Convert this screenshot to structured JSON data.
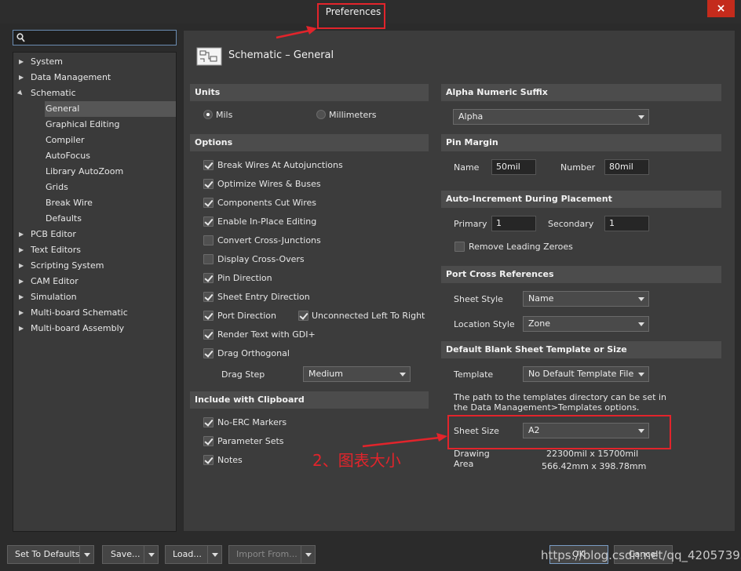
{
  "window": {
    "title": "Preferences",
    "close_label": "×"
  },
  "search": {
    "placeholder": ""
  },
  "tree": {
    "items": [
      {
        "label": "System",
        "expanded": false
      },
      {
        "label": "Data Management",
        "expanded": false
      },
      {
        "label": "Schematic",
        "expanded": true
      },
      {
        "label": "General",
        "selected": true
      },
      {
        "label": "Graphical Editing"
      },
      {
        "label": "Compiler"
      },
      {
        "label": "AutoFocus"
      },
      {
        "label": "Library AutoZoom"
      },
      {
        "label": "Grids"
      },
      {
        "label": "Break Wire"
      },
      {
        "label": "Defaults"
      },
      {
        "label": "PCB Editor",
        "expanded": false
      },
      {
        "label": "Text Editors",
        "expanded": false
      },
      {
        "label": "Scripting System",
        "expanded": false
      },
      {
        "label": "CAM Editor",
        "expanded": false
      },
      {
        "label": "Simulation",
        "expanded": false
      },
      {
        "label": "Multi-board Schematic",
        "expanded": false
      },
      {
        "label": "Multi-board Assembly",
        "expanded": false
      }
    ]
  },
  "page": {
    "title": "Schematic – General"
  },
  "units": {
    "header": "Units",
    "mils": "Mils",
    "millimeters": "Millimeters",
    "selected": "Mils"
  },
  "options": {
    "header": "Options",
    "items": [
      {
        "label": "Break Wires At Autojunctions",
        "checked": true
      },
      {
        "label": "Optimize Wires & Buses",
        "checked": true
      },
      {
        "label": "Components Cut Wires",
        "checked": true
      },
      {
        "label": "Enable In-Place Editing",
        "checked": true
      },
      {
        "label": "Convert Cross-Junctions",
        "checked": false
      },
      {
        "label": "Display Cross-Overs",
        "checked": false
      },
      {
        "label": "Pin Direction",
        "checked": true
      },
      {
        "label": "Sheet Entry Direction",
        "checked": true
      },
      {
        "label": "Port Direction",
        "checked": true
      },
      {
        "label": "Render Text with GDI+",
        "checked": true
      },
      {
        "label": "Drag Orthogonal",
        "checked": true
      }
    ],
    "unconnected": {
      "label": "Unconnected Left To Right",
      "checked": true
    },
    "drag_step_label": "Drag Step",
    "drag_step_value": "Medium"
  },
  "clipboard": {
    "header": "Include with Clipboard",
    "items": [
      {
        "label": "No-ERC Markers",
        "checked": true
      },
      {
        "label": "Parameter Sets",
        "checked": true
      },
      {
        "label": "Notes",
        "checked": true
      }
    ]
  },
  "alpha_suffix": {
    "header": "Alpha Numeric Suffix",
    "value": "Alpha"
  },
  "pin_margin": {
    "header": "Pin Margin",
    "name_label": "Name",
    "name_value": "50mil",
    "number_label": "Number",
    "number_value": "80mil"
  },
  "auto_increment": {
    "header": "Auto-Increment During Placement",
    "primary_label": "Primary",
    "primary_value": "1",
    "secondary_label": "Secondary",
    "secondary_value": "1",
    "remove_zeroes_label": "Remove Leading Zeroes",
    "remove_zeroes_checked": false
  },
  "port_cross": {
    "header": "Port Cross References",
    "sheet_style_label": "Sheet Style",
    "sheet_style_value": "Name",
    "location_style_label": "Location Style",
    "location_style_value": "Zone"
  },
  "template": {
    "header": "Default Blank Sheet Template or Size",
    "template_label": "Template",
    "template_value": "No Default Template File",
    "note_line1": "The path to the templates directory can be set in",
    "note_line2": "the Data Management>Templates options.",
    "sheet_size_label": "Sheet Size",
    "sheet_size_value": "A2",
    "drawing_area_label_1": "Drawing",
    "drawing_area_label_2": "Area",
    "drawing_area_mil": "22300mil x 15700mil",
    "drawing_area_mm": "566.42mm x 398.78mm"
  },
  "footer": {
    "set_defaults": "Set To Defaults",
    "save": "Save...",
    "load": "Load...",
    "import_from": "Import From...",
    "ok": "OK",
    "cancel": "Cancel"
  },
  "annotation": {
    "text": "2、图表大小",
    "color": "#e2242b"
  },
  "watermark": "https://blog.csdn.net/qq_42057393",
  "colors": {
    "accent_red": "#e2242b",
    "background": "#2b2b2b",
    "panel": "#3c3c3c",
    "section_header": "#4c4c4c"
  }
}
